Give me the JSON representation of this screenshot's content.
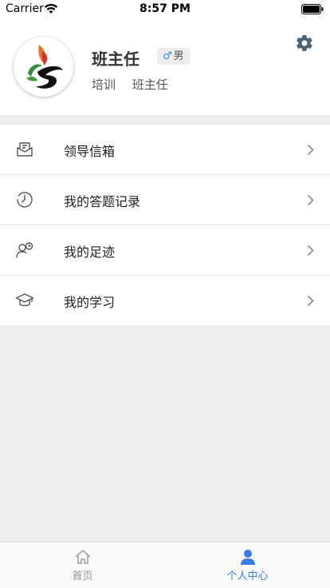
{
  "status_bar": {
    "carrier": "Carrier",
    "time": "8:57 PM"
  },
  "profile": {
    "name": "班主任",
    "gender_symbol": "♂",
    "gender": "男",
    "tags": [
      "培训",
      "班主任"
    ]
  },
  "menu": [
    {
      "label": "领导信箱",
      "icon": "mailbox-icon"
    },
    {
      "label": "我的答题记录",
      "icon": "clock-icon"
    },
    {
      "label": "我的足迹",
      "icon": "user-clock-icon"
    },
    {
      "label": "我的学习",
      "icon": "graduation-cap-icon"
    }
  ],
  "tab_bar": {
    "tabs": [
      {
        "label": "首页",
        "icon": "home-icon",
        "active": false
      },
      {
        "label": "个人中心",
        "icon": "user-icon",
        "active": true
      }
    ]
  },
  "colors": {
    "accent": "#3a7be8",
    "inactive": "#999999",
    "background": "#eeeeee",
    "gender_icon": "#3a8de0"
  }
}
